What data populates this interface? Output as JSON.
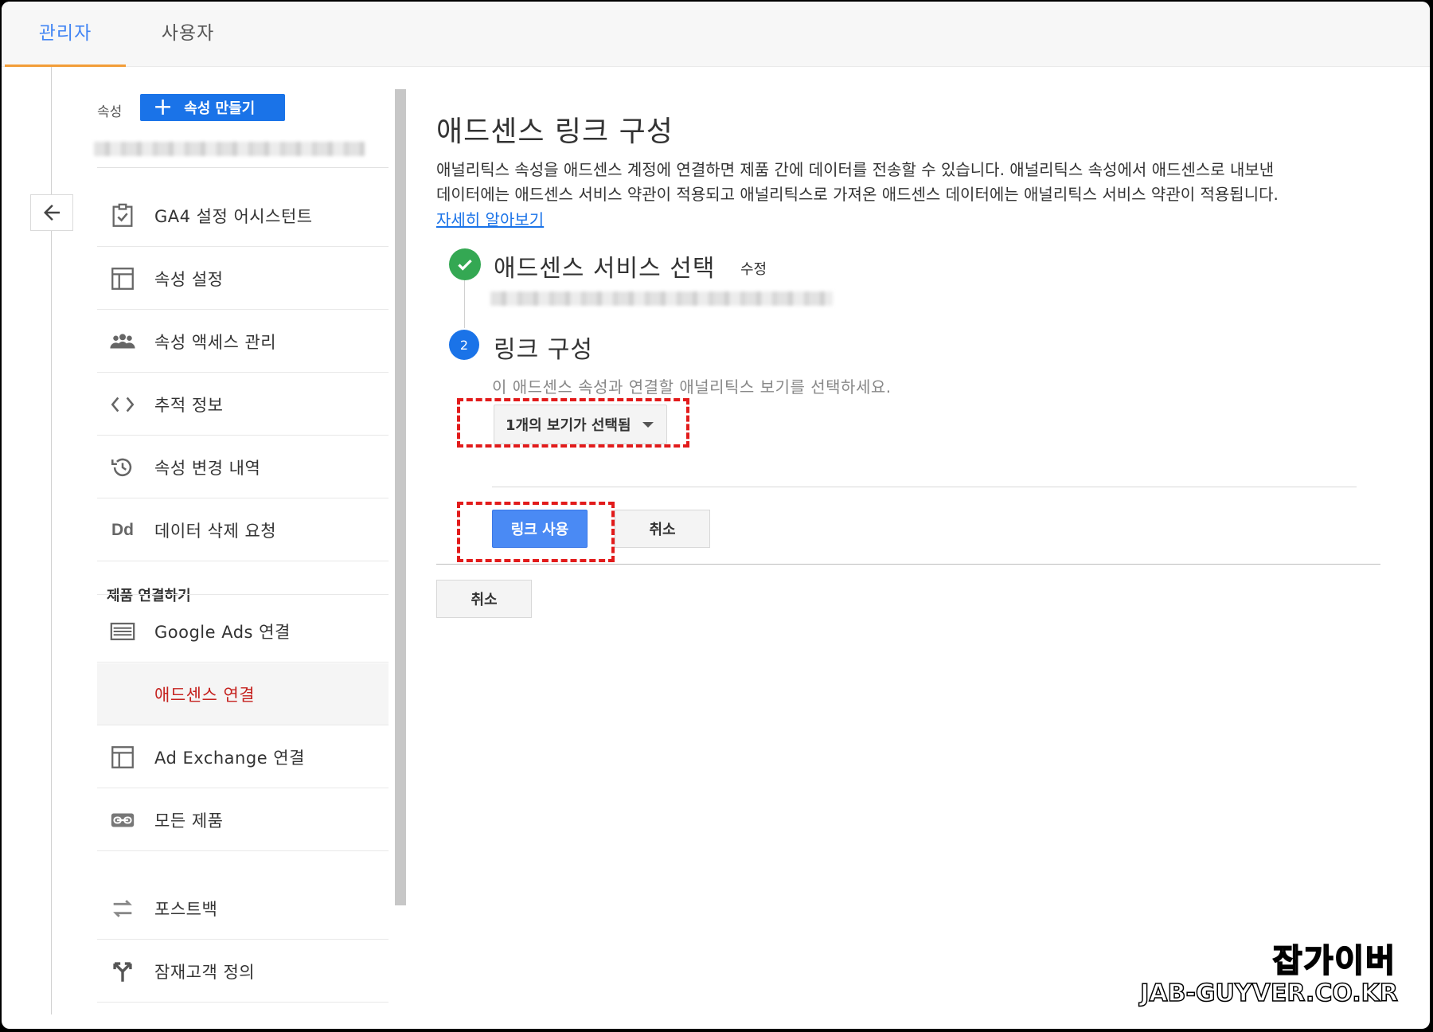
{
  "tabs": [
    {
      "label": "관리자",
      "active": true
    },
    {
      "label": "사용자",
      "active": false
    }
  ],
  "sidebar": {
    "property_label": "속성",
    "create_button": "속성 만들기",
    "items": [
      {
        "label": "GA4 설정 어시스턴트",
        "icon": "checklist-icon"
      },
      {
        "label": "속성 설정",
        "icon": "window-icon"
      },
      {
        "label": "속성 액세스 관리",
        "icon": "people-icon"
      },
      {
        "label": "추적 정보",
        "icon": "code-brackets-icon"
      },
      {
        "label": "속성 변경 내역",
        "icon": "history-icon"
      },
      {
        "label": "데이터 삭제 요청",
        "icon": "dd-icon",
        "icon_text": "Dd"
      }
    ],
    "section_title": "제품 연결하기",
    "product_items": [
      {
        "label": "Google Ads 연결",
        "icon": "ads-icon"
      },
      {
        "label": "애드센스 연결",
        "selected": true
      },
      {
        "label": "Ad Exchange 연결",
        "icon": "window-icon"
      },
      {
        "label": "모든 제품",
        "icon": "link-icon"
      },
      {
        "label": "포스트백",
        "icon": "swap-icon"
      },
      {
        "label": "잠재고객 정의",
        "icon": "fork-icon"
      }
    ]
  },
  "main": {
    "title": "애드센스 링크 구성",
    "description_line1": "애널리틱스 속성을 애드센스 계정에 연결하면 제품 간에 데이터를 전송할 수 있습니다. 애널리틱스 속성에서 애드센스로 내보낸",
    "description_line2": "데이터에는 애드센스 서비스 약관이 적용되고 애널리틱스로 가져온 애드센스 데이터에는 애널리틱스 서비스 약관이 적용됩니다.",
    "learn_more": "자세히 알아보기",
    "step1": {
      "title": "애드센스 서비스 선택",
      "edit": "수정"
    },
    "step2": {
      "number": "2",
      "title": "링크 구성",
      "hint": "이 애드센스 속성과 연결할 애널리틱스 보기를 선택하세요."
    },
    "view_select": "1개의 보기가 선택됨",
    "enable_link_button": "링크 사용",
    "cancel_button": "취소",
    "cancel_button_outer": "취소"
  },
  "watermark": {
    "line1": "잡가이버",
    "line2": "JAB-GUYVER.CO.KR"
  },
  "colors": {
    "accent_blue": "#1a73e8",
    "tab_underline": "#f29d38",
    "selected_text": "#c5221f",
    "check_green": "#34a853",
    "highlight_red": "#e21b1b"
  }
}
